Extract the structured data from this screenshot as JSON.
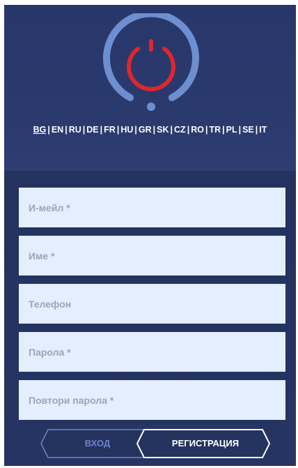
{
  "languages": {
    "active": "BG",
    "items": [
      "BG",
      "EN",
      "RU",
      "DE",
      "FR",
      "HU",
      "GR",
      "SK",
      "CZ",
      "RO",
      "TR",
      "PL",
      "SE",
      "IT"
    ],
    "separator": "|"
  },
  "form": {
    "email_placeholder": "И-мейл *",
    "name_placeholder": "Име *",
    "phone_placeholder": "Телефон",
    "password_placeholder": "Парола *",
    "repeat_password_placeholder": "Повтори парола *"
  },
  "tabs": {
    "login_label": "ВХОД",
    "register_label": "РЕГИСТРАЦИЯ",
    "selected": "register"
  },
  "icons": {
    "logo": "power-icon"
  },
  "colors": {
    "background": "#29386c",
    "ring": "#6d8fd0",
    "power": "#e0262d",
    "field": "#e3eeff",
    "tab_inactive_text": "#6f86ce",
    "tab_border": "#ffffff"
  }
}
